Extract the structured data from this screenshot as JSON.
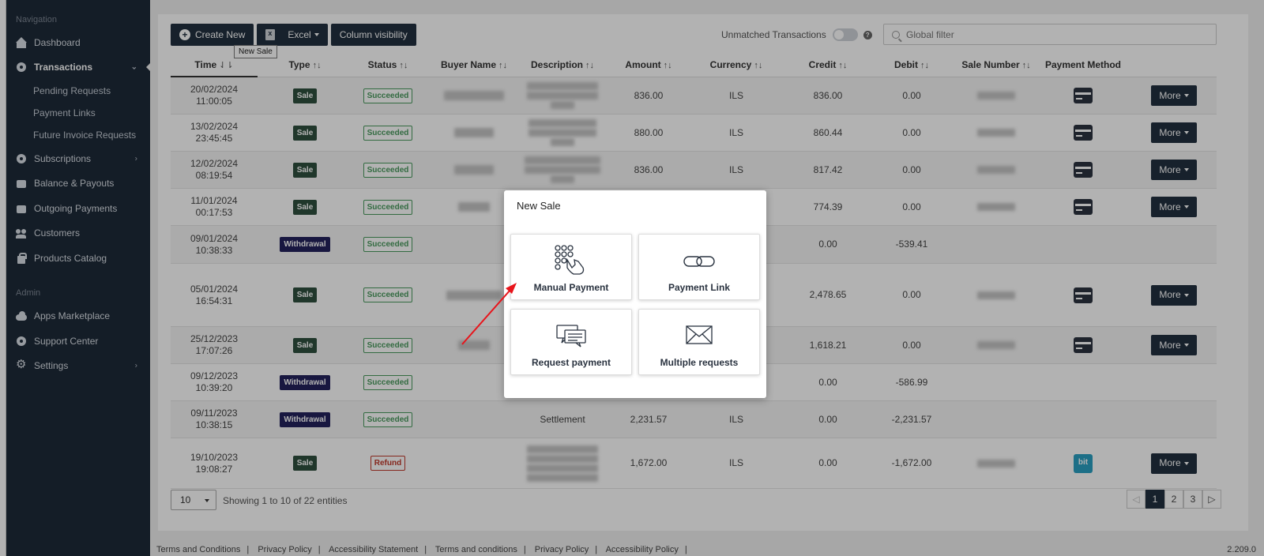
{
  "sidebar": {
    "nav_title": "Navigation",
    "admin_title": "Admin",
    "items": {
      "dashboard": "Dashboard",
      "transactions": "Transactions",
      "pending": "Pending Requests",
      "payment_links": "Payment Links",
      "future_invoice": "Future Invoice Requests",
      "subscriptions": "Subscriptions",
      "balance": "Balance & Payouts",
      "outgoing": "Outgoing Payments",
      "customers": "Customers",
      "products": "Products Catalog",
      "apps": "Apps Marketplace",
      "support": "Support Center",
      "settings": "Settings"
    }
  },
  "toolbar": {
    "create_new": "Create New",
    "excel": "Excel",
    "column_visibility": "Column visibility",
    "tooltip": "New Sale",
    "unmatched": "Unmatched Transactions",
    "global_filter_placeholder": "Global filter"
  },
  "columns": {
    "time": "Time",
    "type": "Type",
    "status": "Status",
    "buyer": "Buyer Name",
    "description": "Description",
    "amount": "Amount",
    "currency": "Currency",
    "credit": "Credit",
    "debit": "Debit",
    "sale_number": "Sale Number",
    "payment_method": "Payment Method"
  },
  "rows": [
    {
      "date": "20/02/2024",
      "time": "11:00:05",
      "type": "Sale",
      "status": "Succeeded",
      "description": "",
      "amount": "836.00",
      "currency": "ILS",
      "credit": "836.00",
      "debit": "0.00",
      "method": "card",
      "more": "More"
    },
    {
      "date": "13/02/2024",
      "time": "23:45:45",
      "type": "Sale",
      "status": "Succeeded",
      "description": "",
      "amount": "880.00",
      "currency": "ILS",
      "credit": "860.44",
      "debit": "0.00",
      "method": "card",
      "more": "More"
    },
    {
      "date": "12/02/2024",
      "time": "08:19:54",
      "type": "Sale",
      "status": "Succeeded",
      "description": "",
      "amount": "836.00",
      "currency": "ILS",
      "credit": "817.42",
      "debit": "0.00",
      "method": "card",
      "more": "More"
    },
    {
      "date": "11/01/2024",
      "time": "00:17:53",
      "type": "Sale",
      "status": "Succeeded",
      "description": "",
      "amount": "",
      "currency": "",
      "credit": "774.39",
      "debit": "0.00",
      "method": "card",
      "more": "More"
    },
    {
      "date": "09/01/2024",
      "time": "10:38:33",
      "type": "Withdrawal",
      "status": "Succeeded",
      "description": "",
      "amount": "",
      "currency": "",
      "credit": "0.00",
      "debit": "-539.41",
      "method": "",
      "more": ""
    },
    {
      "date": "05/01/2024",
      "time": "16:54:31",
      "type": "Sale",
      "status": "Succeeded",
      "description": "",
      "amount": "",
      "currency": "",
      "credit": "2,478.65",
      "debit": "0.00",
      "method": "card",
      "more": "More"
    },
    {
      "date": "25/12/2023",
      "time": "17:07:26",
      "type": "Sale",
      "status": "Succeeded",
      "description": "",
      "amount": "",
      "currency": "",
      "credit": "1,618.21",
      "debit": "0.00",
      "method": "card",
      "more": "More"
    },
    {
      "date": "09/12/2023",
      "time": "10:39:20",
      "type": "Withdrawal",
      "status": "Succeeded",
      "description": "",
      "amount": "",
      "currency": "",
      "credit": "0.00",
      "debit": "-586.99",
      "method": "",
      "more": ""
    },
    {
      "date": "09/11/2023",
      "time": "10:38:15",
      "type": "Withdrawal",
      "status": "Succeeded",
      "description": "Settlement",
      "amount": "2,231.57",
      "currency": "ILS",
      "credit": "0.00",
      "debit": "-2,231.57",
      "method": "",
      "more": ""
    },
    {
      "date": "19/10/2023",
      "time": "19:08:27",
      "type": "Sale",
      "status": "Refund",
      "description": "",
      "amount": "1,672.00",
      "currency": "ILS",
      "credit": "0.00",
      "debit": "-1,672.00",
      "method": "bit",
      "more": "More"
    }
  ],
  "pagination": {
    "page_size": "10",
    "showing": "Showing 1 to 10 of 22 entities",
    "pages": [
      "1",
      "2",
      "3"
    ],
    "current_page": "1"
  },
  "footer": {
    "links": [
      "Terms and Conditions",
      "Privacy Policy",
      "Accessibility Statement",
      "Terms and conditions",
      "Privacy Policy",
      "Accessibility Policy"
    ],
    "version": "2.209.0"
  },
  "modal": {
    "title": "New Sale",
    "tiles": {
      "manual": "Manual Payment",
      "link": "Payment Link",
      "request": "Request payment",
      "multiple": "Multiple requests"
    }
  },
  "bit_label": "bit",
  "colors": {
    "sidebar_bg": "#1e2a38",
    "button_dark": "#22303f",
    "success": "#4a9a5e",
    "refund": "#c0392b",
    "withdrawal": "#23225c",
    "annotation_arrow": "#e8141b"
  }
}
